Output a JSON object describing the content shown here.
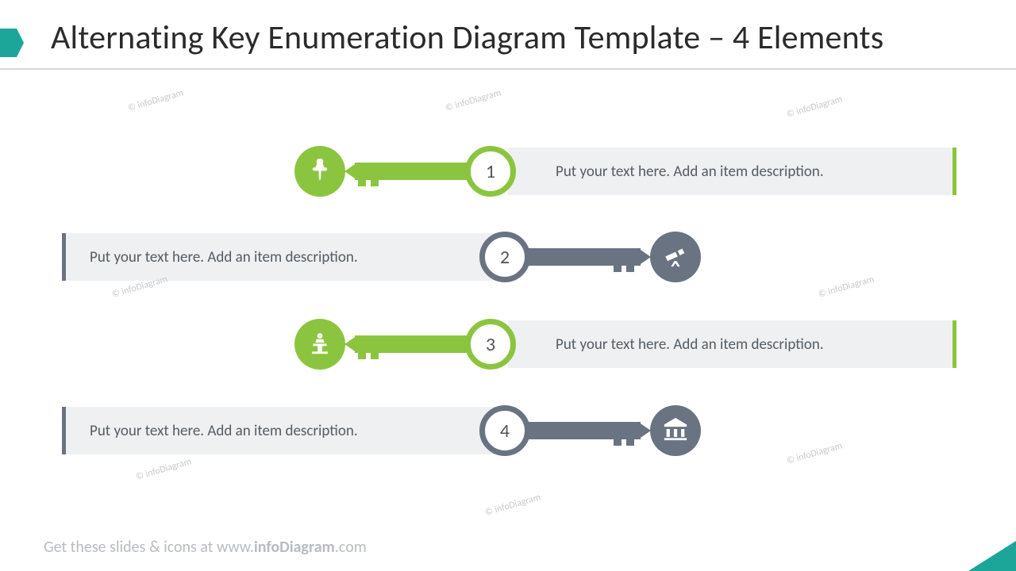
{
  "title": "Alternating Key Enumeration Diagram Template – 4 Elements",
  "footer_prefix": "Get these slides & icons at www.",
  "footer_bold": "infoDiagram",
  "footer_suffix": ".com",
  "watermark": "© infoDiagram",
  "colors": {
    "green": "#8bc53f",
    "gray": "#6a7381",
    "teal": "#1ca69a",
    "bar": "#eef0f1"
  },
  "items": [
    {
      "num": "1",
      "text": "Put your text here. Add an item description.",
      "icon": "pushpin-icon",
      "theme": "green",
      "direction": "left"
    },
    {
      "num": "2",
      "text": "Put your text here. Add an item description.",
      "icon": "telescope-icon",
      "theme": "gray",
      "direction": "right"
    },
    {
      "num": "3",
      "text": "Put your text here. Add an item description.",
      "icon": "speaker-icon",
      "theme": "green",
      "direction": "left"
    },
    {
      "num": "4",
      "text": "Put your text here. Add an item description.",
      "icon": "bank-icon",
      "theme": "gray",
      "direction": "right"
    }
  ]
}
